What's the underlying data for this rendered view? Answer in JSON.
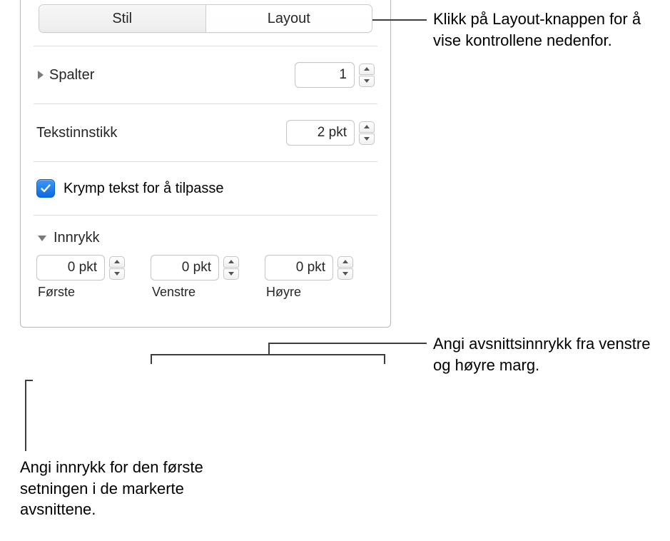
{
  "tabs": {
    "stil": "Stil",
    "layout": "Layout"
  },
  "columns": {
    "label": "Spalter",
    "value": "1"
  },
  "textInset": {
    "label": "Tekstinnstikk",
    "value": "2 pkt"
  },
  "shrink": {
    "label": "Krymp tekst for å tilpasse"
  },
  "indents": {
    "header": "Innrykk",
    "first": {
      "value": "0 pkt",
      "label": "Første"
    },
    "left": {
      "value": "0 pkt",
      "label": "Venstre"
    },
    "right": {
      "value": "0 pkt",
      "label": "Høyre"
    }
  },
  "callouts": {
    "layoutBtn": "Klikk på Layout-knappen for å vise kontrollene nedenfor.",
    "margins": "Angi avsnittsinnrykk fra venstre og høyre marg.",
    "firstLine": "Angi innrykk for den første setningen i de markerte avsnittene."
  }
}
